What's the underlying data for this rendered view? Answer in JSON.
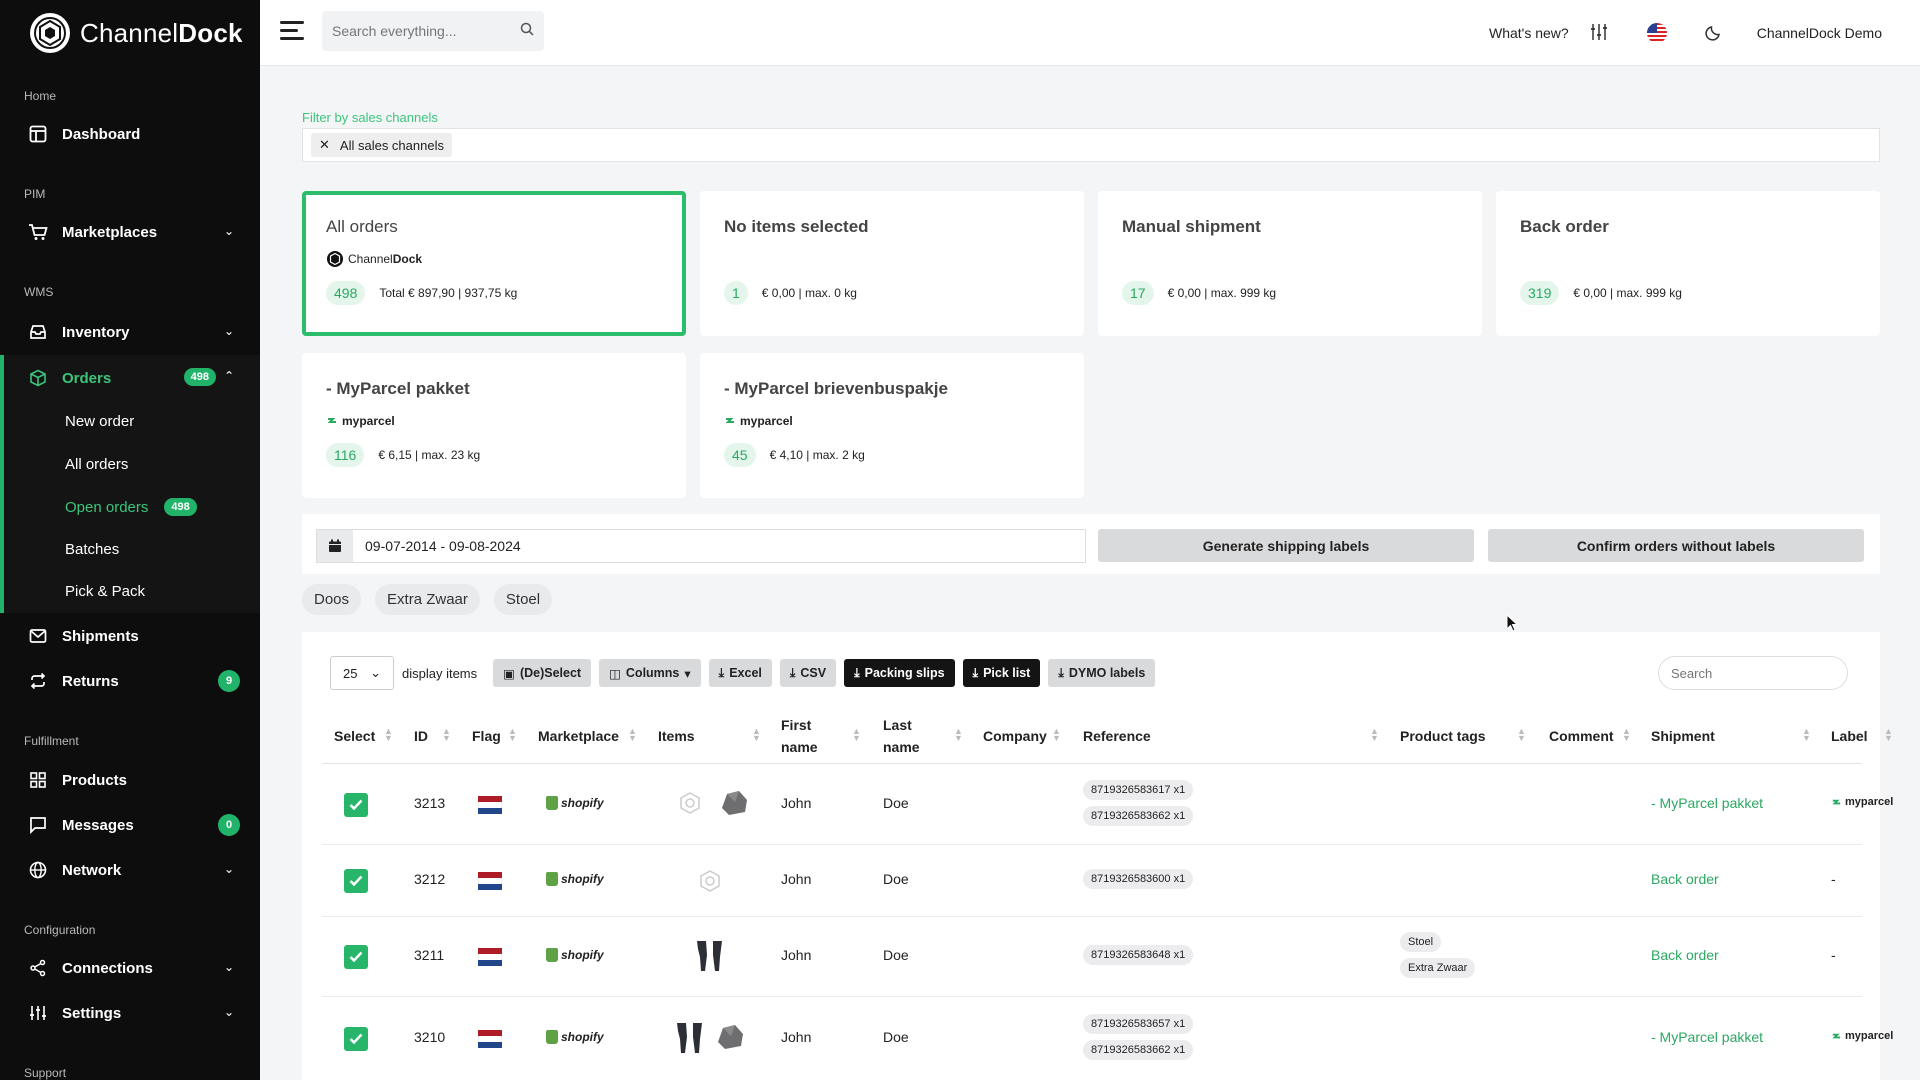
{
  "brand": {
    "name_light": "Channel",
    "name_bold": "Dock"
  },
  "sidebar": {
    "sections": {
      "home": "Home",
      "pim": "PIM",
      "wms": "WMS",
      "fulfillment": "Fulfillment",
      "configuration": "Configuration",
      "support": "Support"
    },
    "items": {
      "dashboard": "Dashboard",
      "marketplaces": "Marketplaces",
      "inventory": "Inventory",
      "orders": "Orders",
      "orders_badge": "498",
      "shipments": "Shipments",
      "returns": "Returns",
      "returns_badge": "9",
      "products": "Products",
      "messages": "Messages",
      "messages_badge": "0",
      "network": "Network",
      "connections": "Connections",
      "settings": "Settings"
    },
    "orders_sub": {
      "new_order": "New order",
      "all_orders": "All orders",
      "open_orders": "Open orders",
      "open_orders_badge": "498",
      "batches": "Batches",
      "pick_pack": "Pick & Pack"
    }
  },
  "topbar": {
    "search_placeholder": "Search everything...",
    "whats_new": "What's new?",
    "account": "ChannelDock Demo"
  },
  "filter": {
    "label": "Filter by sales channels",
    "chip": "All sales channels"
  },
  "cards": [
    {
      "title": "All orders",
      "logo_light": "Channel",
      "logo_bold": "Dock",
      "count": "498",
      "stats": "Total € 897,90 | 937,75 kg"
    },
    {
      "title": "No items selected",
      "count": "1",
      "stats": "€ 0,00 | max. 0 kg"
    },
    {
      "title": "Manual shipment",
      "count": "17",
      "stats": "€ 0,00 | max. 999 kg"
    },
    {
      "title": "Back order",
      "count": "319",
      "stats": "€ 0,00 | max. 999 kg"
    },
    {
      "title": "- MyParcel pakket",
      "logo": "myparcel",
      "count": "116",
      "stats": "€ 6,15 | max. 23 kg"
    },
    {
      "title": "- MyParcel brievenbuspakje",
      "logo": "myparcel",
      "count": "45",
      "stats": "€ 4,10 | max. 2 kg"
    }
  ],
  "actions": {
    "date_range": "09-07-2014 - 09-08-2024",
    "generate_labels": "Generate shipping labels",
    "confirm_without": "Confirm orders without labels"
  },
  "product_tag_filters": [
    "Doos",
    "Extra Zwaar",
    "Stoel"
  ],
  "toolbar": {
    "per_page": "25",
    "display_items": "display items",
    "deselect": "(De)Select",
    "columns": "Columns",
    "excel": "Excel",
    "csv": "CSV",
    "packing_slips": "Packing slips",
    "pick_list": "Pick list",
    "dymo_labels": "DYMO labels",
    "search_placeholder": "Search"
  },
  "table": {
    "headers": {
      "select": "Select",
      "id": "ID",
      "flag": "Flag",
      "marketplace": "Marketplace",
      "items": "Items",
      "first_name_1": "First",
      "first_name_2": "name",
      "last_name_1": "Last",
      "last_name_2": "name",
      "company": "Company",
      "reference": "Reference",
      "product_tags": "Product tags",
      "comment": "Comment",
      "shipment": "Shipment",
      "label": "Label"
    },
    "marketplace_logo": "shopify",
    "rows": [
      {
        "id": "3213",
        "first": "John",
        "last": "Doe",
        "refs": [
          "8719326583617 x1",
          "8719326583662 x1"
        ],
        "tags": [],
        "shipment": "- MyParcel pakket",
        "label": "myparcel"
      },
      {
        "id": "3212",
        "first": "John",
        "last": "Doe",
        "refs": [
          "8719326583600 x1"
        ],
        "tags": [],
        "shipment": "Back order",
        "label": "-"
      },
      {
        "id": "3211",
        "first": "John",
        "last": "Doe",
        "refs": [
          "8719326583648 x1"
        ],
        "tags": [
          "Stoel",
          "Extra Zwaar"
        ],
        "shipment": "Back order",
        "label": "-"
      },
      {
        "id": "3210",
        "first": "John",
        "last": "Doe",
        "refs": [
          "8719326583657 x1",
          "8719326583662 x1"
        ],
        "tags": [],
        "shipment": "- MyParcel pakket",
        "label": "myparcel"
      }
    ]
  },
  "colors": {
    "accent": "#22b36a",
    "sidebar_bg": "#0d0d0d",
    "nl_red": "#ae1c28",
    "nl_blue": "#21468b"
  }
}
